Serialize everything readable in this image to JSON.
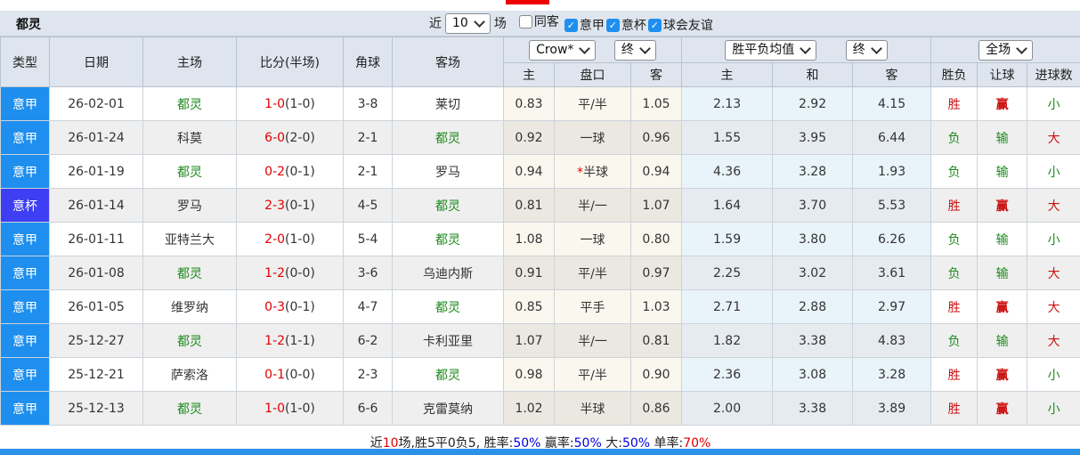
{
  "page": {
    "team_title": "都灵"
  },
  "filters": {
    "recent_label": "近",
    "recent_value": "10",
    "games_label": "场",
    "checkboxes": [
      {
        "label": "同客",
        "checked": false
      },
      {
        "label": "意甲",
        "checked": true
      },
      {
        "label": "意杯",
        "checked": true
      },
      {
        "label": "球会友谊",
        "checked": true
      }
    ]
  },
  "table": {
    "main_headers": [
      "类型",
      "日期",
      "主场",
      "比分(半场)",
      "角球",
      "客场"
    ],
    "odds_selects": {
      "company": "Crow*",
      "company_state": "终",
      "avg": "胜平负均值",
      "avg_state": "终",
      "scope": "全场"
    },
    "sub_headers": [
      "主",
      "盘口",
      "客",
      "主",
      "和",
      "客",
      "胜负",
      "让球",
      "进球数"
    ],
    "rows": [
      {
        "league": "意甲",
        "league_type": "seriea",
        "date": "26-02-01",
        "home": "都灵",
        "home_highlight": true,
        "score": "1-0",
        "half": "(1-0)",
        "corner": "3-8",
        "away": "莱切",
        "away_highlight": false,
        "odds_home": "0.83",
        "handicap": "平/半",
        "handicap_star": false,
        "odds_away": "1.05",
        "avg_home": "2.13",
        "avg_draw": "2.92",
        "avg_away": "4.15",
        "result": "胜",
        "result_color": "red",
        "handicap_result": "赢",
        "handicap_result_color": "red",
        "goals_result": "小",
        "goals_color": "green"
      },
      {
        "league": "意甲",
        "league_type": "seriea",
        "date": "26-01-24",
        "home": "科莫",
        "home_highlight": false,
        "score": "6-0",
        "half": "(2-0)",
        "corner": "2-1",
        "away": "都灵",
        "away_highlight": true,
        "odds_home": "0.92",
        "handicap": "一球",
        "handicap_star": false,
        "odds_away": "0.96",
        "avg_home": "1.55",
        "avg_draw": "3.95",
        "avg_away": "6.44",
        "result": "负",
        "result_color": "green",
        "handicap_result": "输",
        "handicap_result_color": "green",
        "goals_result": "大",
        "goals_color": "red"
      },
      {
        "league": "意甲",
        "league_type": "seriea",
        "date": "26-01-19",
        "home": "都灵",
        "home_highlight": true,
        "score": "0-2",
        "half": "(0-1)",
        "corner": "2-1",
        "away": "罗马",
        "away_highlight": false,
        "odds_home": "0.94",
        "handicap": "半球",
        "handicap_star": true,
        "odds_away": "0.94",
        "avg_home": "4.36",
        "avg_draw": "3.28",
        "avg_away": "1.93",
        "result": "负",
        "result_color": "green",
        "handicap_result": "输",
        "handicap_result_color": "green",
        "goals_result": "小",
        "goals_color": "green"
      },
      {
        "league": "意杯",
        "league_type": "cup",
        "date": "26-01-14",
        "home": "罗马",
        "home_highlight": false,
        "score": "2-3",
        "half": "(0-1)",
        "corner": "4-5",
        "away": "都灵",
        "away_highlight": true,
        "odds_home": "0.81",
        "handicap": "半/一",
        "handicap_star": false,
        "odds_away": "1.07",
        "avg_home": "1.64",
        "avg_draw": "3.70",
        "avg_away": "5.53",
        "result": "胜",
        "result_color": "red",
        "handicap_result": "赢",
        "handicap_result_color": "red",
        "goals_result": "大",
        "goals_color": "red"
      },
      {
        "league": "意甲",
        "league_type": "seriea",
        "date": "26-01-11",
        "home": "亚特兰大",
        "home_highlight": false,
        "score": "2-0",
        "half": "(1-0)",
        "corner": "5-4",
        "away": "都灵",
        "away_highlight": true,
        "odds_home": "1.08",
        "handicap": "一球",
        "handicap_star": false,
        "odds_away": "0.80",
        "avg_home": "1.59",
        "avg_draw": "3.80",
        "avg_away": "6.26",
        "result": "负",
        "result_color": "green",
        "handicap_result": "输",
        "handicap_result_color": "green",
        "goals_result": "小",
        "goals_color": "green"
      },
      {
        "league": "意甲",
        "league_type": "seriea",
        "date": "26-01-08",
        "home": "都灵",
        "home_highlight": true,
        "score": "1-2",
        "half": "(0-0)",
        "corner": "3-6",
        "away": "乌迪内斯",
        "away_highlight": false,
        "odds_home": "0.91",
        "handicap": "平/半",
        "handicap_star": false,
        "odds_away": "0.97",
        "avg_home": "2.25",
        "avg_draw": "3.02",
        "avg_away": "3.61",
        "result": "负",
        "result_color": "green",
        "handicap_result": "输",
        "handicap_result_color": "green",
        "goals_result": "大",
        "goals_color": "red"
      },
      {
        "league": "意甲",
        "league_type": "seriea",
        "date": "26-01-05",
        "home": "维罗纳",
        "home_highlight": false,
        "score": "0-3",
        "half": "(0-1)",
        "corner": "4-7",
        "away": "都灵",
        "away_highlight": true,
        "odds_home": "0.85",
        "handicap": "平手",
        "handicap_star": false,
        "odds_away": "1.03",
        "avg_home": "2.71",
        "avg_draw": "2.88",
        "avg_away": "2.97",
        "result": "胜",
        "result_color": "red",
        "handicap_result": "赢",
        "handicap_result_color": "red",
        "goals_result": "大",
        "goals_color": "red"
      },
      {
        "league": "意甲",
        "league_type": "seriea",
        "date": "25-12-27",
        "home": "都灵",
        "home_highlight": true,
        "score": "1-2",
        "half": "(1-1)",
        "corner": "6-2",
        "away": "卡利亚里",
        "away_highlight": false,
        "odds_home": "1.07",
        "handicap": "半/一",
        "handicap_star": false,
        "odds_away": "0.81",
        "avg_home": "1.82",
        "avg_draw": "3.38",
        "avg_away": "4.83",
        "result": "负",
        "result_color": "green",
        "handicap_result": "输",
        "handicap_result_color": "green",
        "goals_result": "大",
        "goals_color": "red"
      },
      {
        "league": "意甲",
        "league_type": "seriea",
        "date": "25-12-21",
        "home": "萨索洛",
        "home_highlight": false,
        "score": "0-1",
        "half": "(0-0)",
        "corner": "2-3",
        "away": "都灵",
        "away_highlight": true,
        "odds_home": "0.98",
        "handicap": "平/半",
        "handicap_star": false,
        "odds_away": "0.90",
        "avg_home": "2.36",
        "avg_draw": "3.08",
        "avg_away": "3.28",
        "result": "胜",
        "result_color": "red",
        "handicap_result": "赢",
        "handicap_result_color": "red",
        "goals_result": "小",
        "goals_color": "green"
      },
      {
        "league": "意甲",
        "league_type": "seriea",
        "date": "25-12-13",
        "home": "都灵",
        "home_highlight": true,
        "score": "1-0",
        "half": "(1-0)",
        "corner": "6-6",
        "away": "克雷莫纳",
        "away_highlight": false,
        "odds_home": "1.02",
        "handicap": "半球",
        "handicap_star": false,
        "odds_away": "0.86",
        "avg_home": "2.00",
        "avg_draw": "3.38",
        "avg_away": "3.89",
        "result": "胜",
        "result_color": "red",
        "handicap_result": "赢",
        "handicap_result_color": "red",
        "goals_result": "小",
        "goals_color": "green"
      }
    ]
  },
  "footer": {
    "segments": [
      {
        "text": "近",
        "color": "dark"
      },
      {
        "text": "10",
        "color": "red"
      },
      {
        "text": "场,胜5平0负5, 胜率:",
        "color": "dark"
      },
      {
        "text": "50%",
        "color": "blue"
      },
      {
        "text": " 赢率:",
        "color": "dark"
      },
      {
        "text": "50%",
        "color": "blue"
      },
      {
        "text": " 大:",
        "color": "dark"
      },
      {
        "text": "50%",
        "color": "blue"
      },
      {
        "text": " 单率:",
        "color": "dark"
      },
      {
        "text": "70%",
        "color": "red"
      }
    ]
  },
  "colors": {
    "serie_a_badge": "#1e8fee",
    "cup_badge": "#3e3ef2",
    "win_red": "#cc1111",
    "lose_green": "#1e8a1e",
    "score_red": "#e00000",
    "accent_blue": "#1e8fee",
    "bottom_bar_blue": "#2a93e8"
  }
}
